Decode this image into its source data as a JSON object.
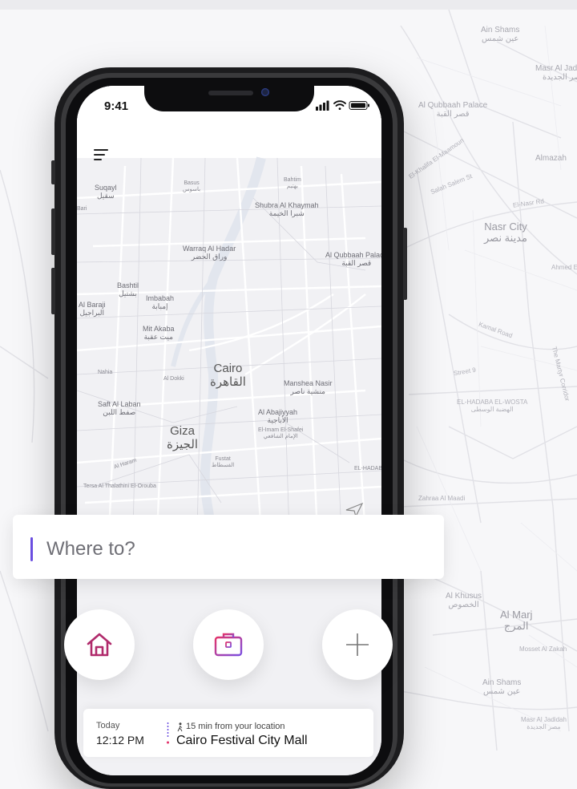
{
  "status": {
    "time": "9:41"
  },
  "search": {
    "placeholder": "Where to?"
  },
  "background_map": {
    "labels": [
      {
        "en": "Ain Shams",
        "ar": "عين شمس"
      },
      {
        "en": "Masr Al Jadidah",
        "ar": "مصر الجديدة"
      },
      {
        "en": "Al Qubbaah Palace",
        "ar": "قصر القبة"
      },
      {
        "en": "Almazah"
      },
      {
        "en": "Nasr City",
        "ar": "مدينة نصر"
      },
      {
        "en": "Salah Salem St"
      },
      {
        "en": "El-Nasr Rd"
      },
      {
        "en": "Ahmed El Zomor"
      },
      {
        "en": "Zahraa Al Maadi"
      },
      {
        "en": "EL-HADABA EL-WOSTA",
        "ar": "الهضبة الوسطى"
      },
      {
        "en": "Al Khusus",
        "ar": "الخصوص"
      },
      {
        "en": "Al Marj",
        "ar": "المرج"
      },
      {
        "en": "Ain Shams",
        "ar": "عين شمس"
      },
      {
        "en": "Masr Al Jadidah",
        "ar": "مصر الجديدة"
      },
      {
        "en": "Kamal Road"
      },
      {
        "en": "Street 9"
      },
      {
        "en": "The Martyr Corridor"
      },
      {
        "en": "Mosset Al Zakah"
      },
      {
        "en": "El-Khalifa El-Maamoun"
      }
    ]
  },
  "phone_map": {
    "labels": [
      {
        "en": "Cairo",
        "ar": "القاهرة"
      },
      {
        "en": "Giza",
        "ar": "الجيزة"
      },
      {
        "en": "Warraq Al Hadar",
        "ar": "وراق الحضر"
      },
      {
        "en": "Shubra Al Khaymah",
        "ar": "شبرا الخيمة"
      },
      {
        "en": "Bahtim",
        "ar": "بهتيم"
      },
      {
        "en": "Basus",
        "ar": "باسوس"
      },
      {
        "en": "Suqayl",
        "ar": "سقيل"
      },
      {
        "en": "Imbabah",
        "ar": "إمبابة"
      },
      {
        "en": "Bashtil",
        "ar": "بشتيل"
      },
      {
        "en": "Al Baraji",
        "ar": "البراجيل"
      },
      {
        "en": "Mit Akaba",
        "ar": "ميت عقبة"
      },
      {
        "en": "Al Qubbaah Palace",
        "ar": "قصر القبة"
      },
      {
        "en": "Manshea Nasir",
        "ar": "منشية ناصر"
      },
      {
        "en": "Al Abajiyyah",
        "ar": "الأباجية"
      },
      {
        "en": "El-Imam El-Shafei",
        "ar": "الإمام الشافعي"
      },
      {
        "en": "Fustat",
        "ar": "الفسطاط"
      },
      {
        "en": "Saft Al Laban",
        "ar": "صفط اللبن"
      },
      {
        "en": "Al Dokki",
        "ar": "الدقي"
      },
      {
        "en": "Nahia"
      },
      {
        "en": "Al Haram"
      },
      {
        "en": "Tersa Al Thalathini El-Orouba"
      },
      {
        "en": "EL-HADAB EL-WOST"
      },
      {
        "en": "Bari"
      }
    ]
  },
  "nav": {
    "home": "home",
    "work": "work",
    "add": "add"
  },
  "trip": {
    "day": "Today",
    "time": "12:12 PM",
    "distance": "15 min from your location",
    "destination": "Cairo Festival City Mall"
  },
  "colors": {
    "accent": "#6a4ee0",
    "home_icon": "#b02a6b",
    "work_gradient_start": "#e2336b",
    "work_gradient_end": "#7b4ee0"
  }
}
